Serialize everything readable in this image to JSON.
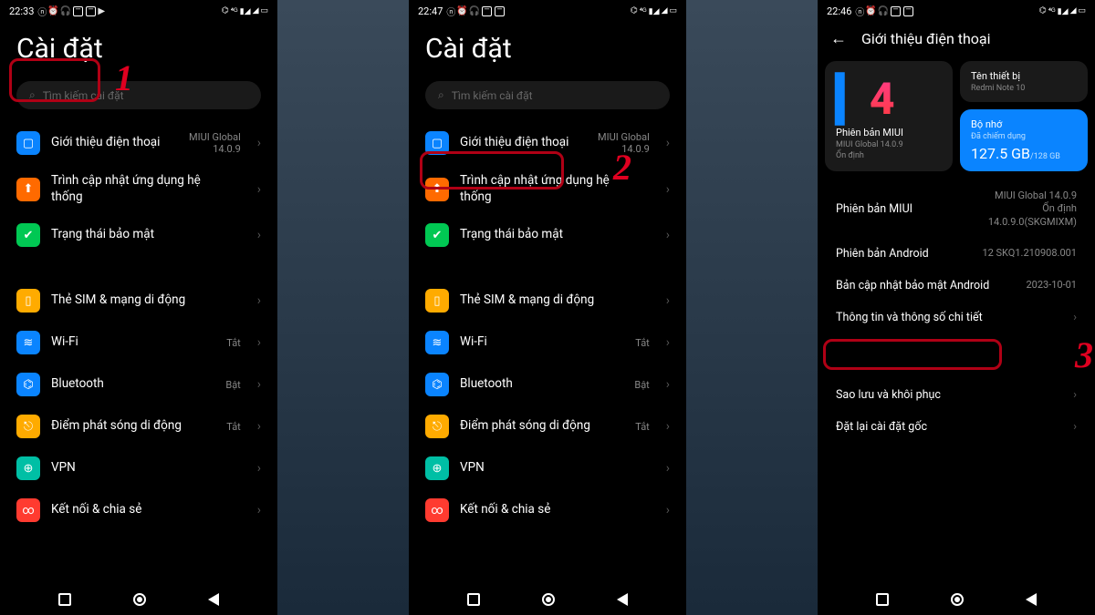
{
  "screens": {
    "s1": {
      "time": "22:33",
      "title": "Cài đặt",
      "search_placeholder": "Tìm kiếm cài đặt",
      "annotation": "1"
    },
    "s2": {
      "time": "22:47",
      "title": "Cài đặt",
      "search_placeholder": "Tìm kiếm cài đặt",
      "annotation": "2"
    },
    "s3": {
      "time": "22:46",
      "title": "Giới thiệu điện thoại",
      "annotation": "3",
      "device_name_label": "Tên thiết bị",
      "device_name_value": "Redmi Note 10",
      "miui_label": "Phiên bản MIUI",
      "miui_value1": "MIUI Global 14.0.9",
      "miui_value2": "Ổn định",
      "storage_label": "Bộ nhớ",
      "storage_sub": "Đã chiếm dụng",
      "storage_used": "127.5 GB",
      "storage_total": "/128 GB",
      "info": [
        {
          "k": "Phiên bản MIUI",
          "v": "MIUI Global 14.0.9\nỔn định\n14.0.9.0(SKGMIXM)"
        },
        {
          "k": "Phiên bản Android",
          "v": "12 SKQ1.210908.001"
        },
        {
          "k": "Bản cập nhật bảo mật Android",
          "v": "2023-10-01"
        },
        {
          "k": "Thông tin và thông số chi tiết",
          "v": "",
          "chev": true
        }
      ],
      "info2": [
        {
          "k": "Sao lưu và khôi phục",
          "v": "",
          "chev": true
        },
        {
          "k": "Đặt lại cài đặt gốc",
          "v": "",
          "chev": true
        }
      ]
    }
  },
  "settings_list": {
    "g1": [
      {
        "icon": "about-phone-icon",
        "cls": "ic-blue",
        "glyph": "▢",
        "title": "Giới thiệu điện thoại",
        "value": "MIUI Global\n14.0.9"
      },
      {
        "icon": "update-icon",
        "cls": "ic-orange",
        "glyph": "⬆",
        "title": "Trình cập nhật ứng dụng hệ thống",
        "value": ""
      },
      {
        "icon": "security-status-icon",
        "cls": "ic-green",
        "glyph": "✔",
        "title": "Trạng thái bảo mật",
        "value": ""
      }
    ],
    "g2": [
      {
        "icon": "sim-icon",
        "cls": "ic-yellow",
        "glyph": "▯",
        "title": "Thẻ SIM & mạng di động",
        "value": ""
      },
      {
        "icon": "wifi-icon",
        "cls": "ic-lightblue",
        "glyph": "≋",
        "title": "Wi-Fi",
        "value": "Tắt"
      },
      {
        "icon": "bluetooth-icon",
        "cls": "ic-lightblue",
        "glyph": "⌬",
        "title": "Bluetooth",
        "value": "Bật"
      },
      {
        "icon": "hotspot-icon",
        "cls": "ic-yellow",
        "glyph": "⎋",
        "title": "Điểm phát sóng di động",
        "value": "Tắt"
      },
      {
        "icon": "vpn-icon",
        "cls": "ic-teal",
        "glyph": "⊕",
        "title": "VPN",
        "value": ""
      },
      {
        "icon": "share-icon",
        "cls": "ic-red",
        "glyph": "∞",
        "title": "Kết nối & chia sẻ",
        "value": ""
      }
    ]
  }
}
